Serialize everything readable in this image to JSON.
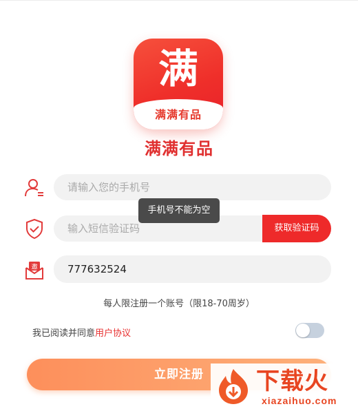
{
  "logo": {
    "character": "满",
    "banner_text": "满满有品"
  },
  "app_name": "满满有品",
  "form": {
    "phone_placeholder": "请输入您的手机号",
    "code_placeholder": "输入短信验证码",
    "get_code_label": "获取验证码",
    "invite_value": "777632524",
    "invite_badge": "邀"
  },
  "toast": "手机号不能为空",
  "rule_note": "每人限注册一个账号（限18-70周岁）",
  "agreement": {
    "prefix": "我已阅读并同意",
    "link": "用户协议",
    "checked": false
  },
  "register_label": "立即注册",
  "watermark": {
    "title": "下载火",
    "subtitle": "xiazaihuo.com"
  },
  "colors": {
    "brand_red": "#ee2a2a",
    "register_gradient_start": "#fd8f5b",
    "toggle_off": "#c6d1de"
  }
}
